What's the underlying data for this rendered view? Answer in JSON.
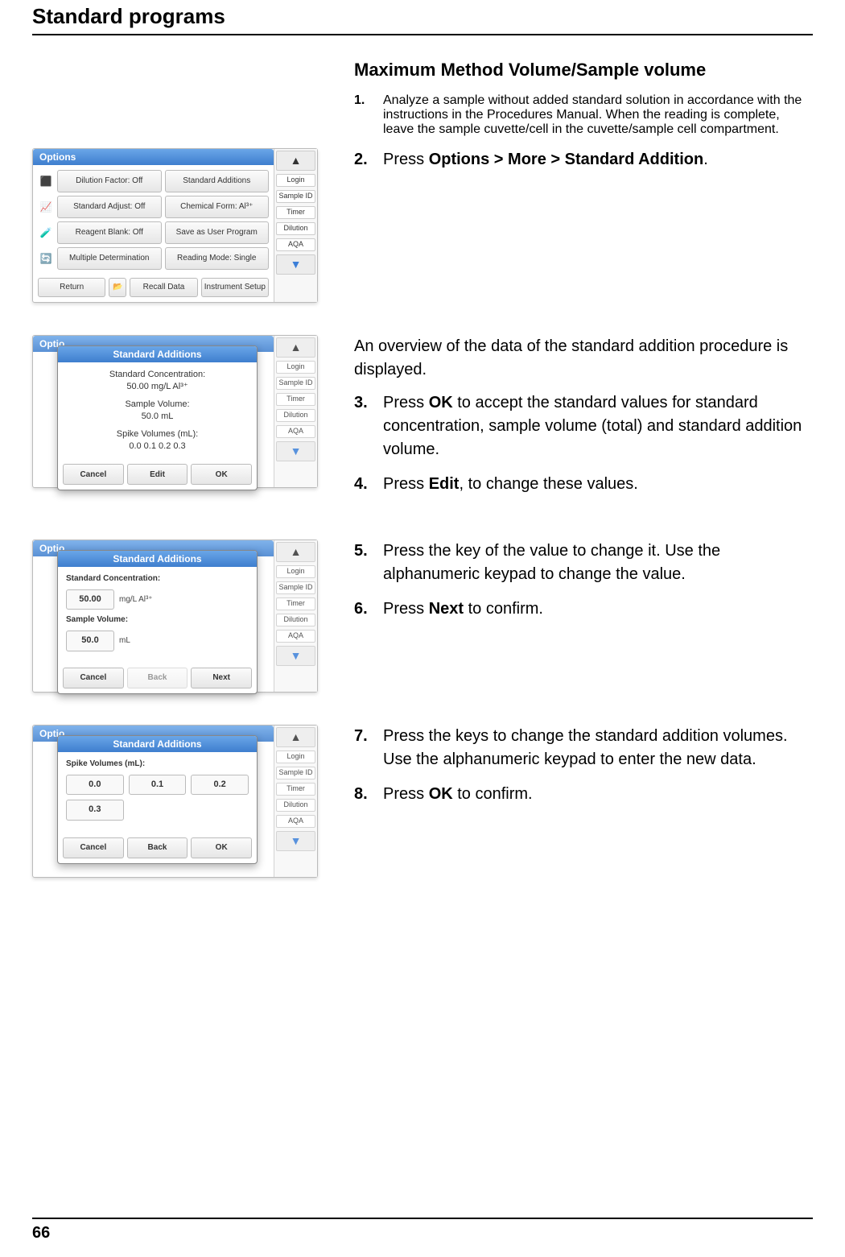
{
  "page": {
    "header": "Standard programs",
    "number": "66"
  },
  "main": {
    "section_title": "Maximum Method Volume/Sample volume",
    "intro_step": {
      "num": "1.",
      "text": "Analyze a sample without added standard solution in accordance with the instructions in the Procedures Manual. When the reading is complete, leave the sample cuvette/cell in the cuvette/sample cell compartment."
    },
    "blocks": [
      {
        "steps": [
          {
            "num": "2.",
            "text_pre": "Press ",
            "bold": "Options > More > Standard Addition",
            "text_post": "."
          }
        ]
      },
      {
        "intro": "An overview of the data of the standard addition procedure is displayed.",
        "steps": [
          {
            "num": "3.",
            "text_pre": "Press ",
            "bold": "OK",
            "text_post": " to accept the standard values for standard concentration, sample volume (total) and standard addition volume."
          },
          {
            "num": "4.",
            "text_pre": "Press ",
            "bold": "Edit",
            "text_post": ", to change these values."
          }
        ]
      },
      {
        "steps": [
          {
            "num": "5.",
            "text_pre": "Press the key of the value to change it. Use the alphanumeric keypad to change the value.",
            "bold": "",
            "text_post": ""
          },
          {
            "num": "6.",
            "text_pre": "Press ",
            "bold": "Next",
            "text_post": " to confirm."
          }
        ]
      },
      {
        "steps": [
          {
            "num": "7.",
            "text_pre": "Press the keys to change the standard addition volumes. Use the alphanumeric keypad to enter the new data.",
            "bold": "",
            "text_post": ""
          },
          {
            "num": "8.",
            "text_pre": "Press ",
            "bold": "OK",
            "text_post": " to confirm."
          }
        ]
      }
    ]
  },
  "screens": {
    "sidebar": {
      "up": "▲",
      "login": "Login",
      "sample_id": "Sample ID",
      "timer": "Timer",
      "dilution": "Dilution",
      "aqa": "AQA",
      "down": "▼"
    },
    "options": {
      "title": "Options",
      "rows": [
        {
          "left": "Dilution Factor: Off",
          "right": "Standard Additions"
        },
        {
          "left": "Standard Adjust: Off",
          "right": "Chemical Form: Al³⁺"
        },
        {
          "left": "Reagent Blank: Off",
          "right": "Save as User Program"
        },
        {
          "left": "Multiple Determination",
          "right": "Reading Mode: Single"
        }
      ],
      "bottom": [
        "Return",
        "Recall Data",
        "Instrument Setup"
      ]
    },
    "modal_overview": {
      "title": "Standard Additions",
      "l1": "Standard Concentration:",
      "l1v": "50.00 mg/L Al³⁺",
      "l2": "Sample Volume:",
      "l2v": "50.0 mL",
      "l3": "Spike Volumes (mL):",
      "l3v": "0.0 0.1 0.2 0.3",
      "buttons": [
        "Cancel",
        "Edit",
        "OK"
      ]
    },
    "modal_edit1": {
      "title": "Standard Additions",
      "f1_label": "Standard Concentration:",
      "f1_value": "50.00",
      "f1_unit": "mg/L Al³⁺",
      "f2_label": "Sample Volume:",
      "f2_value": "50.0",
      "f2_unit": "mL",
      "buttons": [
        "Cancel",
        "Back",
        "Next"
      ]
    },
    "modal_edit2": {
      "title": "Standard Additions",
      "label": "Spike Volumes (mL):",
      "values": [
        "0.0",
        "0.1",
        "0.2",
        "0.3"
      ],
      "buttons": [
        "Cancel",
        "Back",
        "OK"
      ]
    }
  }
}
